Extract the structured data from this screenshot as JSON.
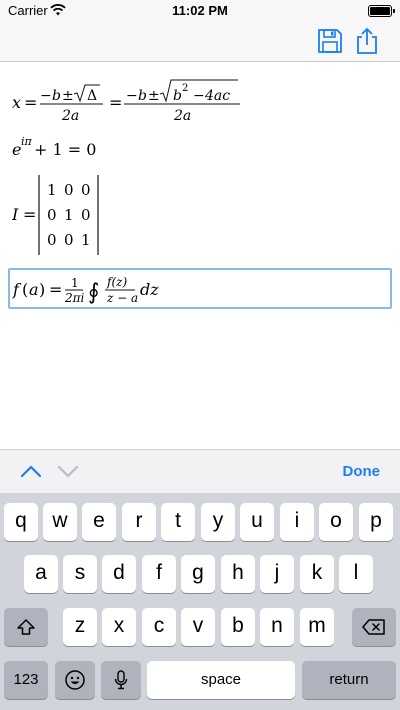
{
  "status": {
    "carrier": "Carrier",
    "time": "11:02 PM"
  },
  "nav": {
    "save_icon": "floppy-disk-icon",
    "share_icon": "share-icon"
  },
  "equations": {
    "eq1": {
      "lhs": "x",
      "b": "b",
      "radicand1": "Δ",
      "den": "2a",
      "radicand2": "b² − 4ac"
    },
    "eq2": {
      "expr": "e^{iπ} + 1 = 0"
    },
    "eq3": {
      "matrix": [
        [
          "1",
          "0",
          "0"
        ],
        [
          "0",
          "1",
          "0"
        ],
        [
          "0",
          "0",
          "1"
        ]
      ]
    },
    "eq4": {
      "expr": "f(a) = 1/(2πi) ∮ f(z)/(z − a) dz"
    }
  },
  "accessory": {
    "done_label": "Done"
  },
  "keyboard": {
    "row1": [
      "q",
      "w",
      "e",
      "r",
      "t",
      "y",
      "u",
      "i",
      "o",
      "p"
    ],
    "row2": [
      "a",
      "s",
      "d",
      "f",
      "g",
      "h",
      "j",
      "k",
      "l"
    ],
    "row3": [
      "z",
      "x",
      "c",
      "v",
      "b",
      "n",
      "m"
    ],
    "numbers_label": "123",
    "space_label": "space",
    "return_label": "return"
  },
  "colors": {
    "accent": "#1a7ff0",
    "focus_border": "#8ab8e8",
    "keyboard_bg": "#d1d4da"
  }
}
